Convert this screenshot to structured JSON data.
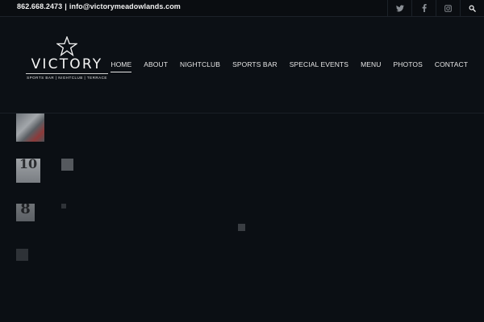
{
  "topbar": {
    "phone": "862.668.2473",
    "separator": "|",
    "email": "info@victorymeadowlands.com",
    "social": [
      {
        "icon": "twitter-icon"
      },
      {
        "icon": "facebook-icon"
      },
      {
        "icon": "instagram-icon"
      },
      {
        "icon": "search-icon"
      }
    ]
  },
  "logo": {
    "wordmark": "VICTORY",
    "tagline": "SPORTS BAR | NIGHTCLUB | TERRACE"
  },
  "nav": {
    "items": [
      {
        "label": "HOME",
        "active": true
      },
      {
        "label": "ABOUT"
      },
      {
        "label": "NIGHTCLUB"
      },
      {
        "label": "SPORTS BAR"
      },
      {
        "label": "SPECIAL EVENTS"
      },
      {
        "label": "MENU"
      },
      {
        "label": "PHOTOS"
      },
      {
        "label": "CONTACT"
      }
    ]
  },
  "gallery": {
    "thumb2_text": "10",
    "thumb4_text": "8"
  },
  "colors": {
    "background": "#0b0f14",
    "text": "#e6e6e6",
    "muted_icon": "#8a8f95"
  }
}
